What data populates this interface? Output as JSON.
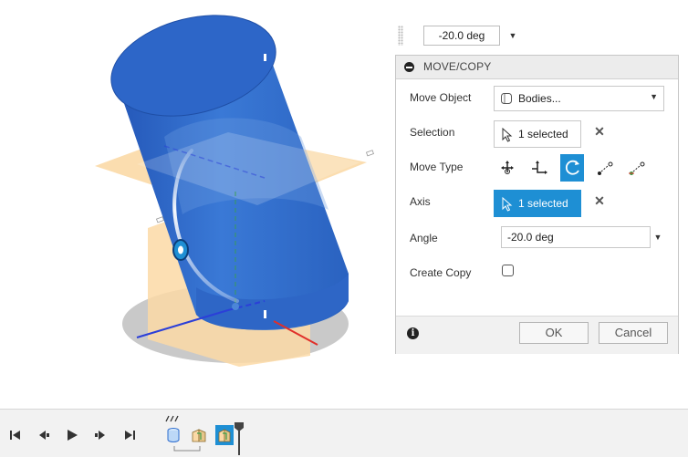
{
  "mini_input": {
    "value": "-20.0 deg"
  },
  "dialog": {
    "title": "MOVE/COPY",
    "move_object": {
      "label": "Move Object",
      "value": "Bodies...",
      "icon": "body-icon"
    },
    "selection": {
      "label": "Selection",
      "value": "1 selected",
      "icon": "cursor-arrow-icon"
    },
    "move_type": {
      "label": "Move Type",
      "options": [
        {
          "name": "free-move",
          "icon": "free-move-icon"
        },
        {
          "name": "translate-xyz",
          "icon": "translate-xyz-icon"
        },
        {
          "name": "rotate",
          "icon": "rotate-icon",
          "active": true
        },
        {
          "name": "point-to-point",
          "icon": "point-to-point-icon"
        },
        {
          "name": "point-to-position",
          "icon": "point-to-position-icon"
        }
      ]
    },
    "axis": {
      "label": "Axis",
      "value": "1 selected"
    },
    "angle": {
      "label": "Angle",
      "value": "-20.0 deg"
    },
    "create_copy": {
      "label": "Create Copy",
      "checked": false
    },
    "ok_label": "OK",
    "cancel_label": "Cancel"
  },
  "timeline": {
    "controls": [
      "go-to-start-icon",
      "step-back-icon",
      "play-icon",
      "step-forward-icon",
      "go-to-end-icon"
    ],
    "features": [
      "body-feature-icon",
      "move-feature-icon",
      "active-move-feature-icon"
    ]
  },
  "colors": {
    "body_blue": "#2f6ecf",
    "accent": "#1e8fd4",
    "plane_orange": "#fbd9a6",
    "axis_red": "#e0302a",
    "axis_blue": "#2b3fd8",
    "axis_green": "#3aa04a"
  }
}
